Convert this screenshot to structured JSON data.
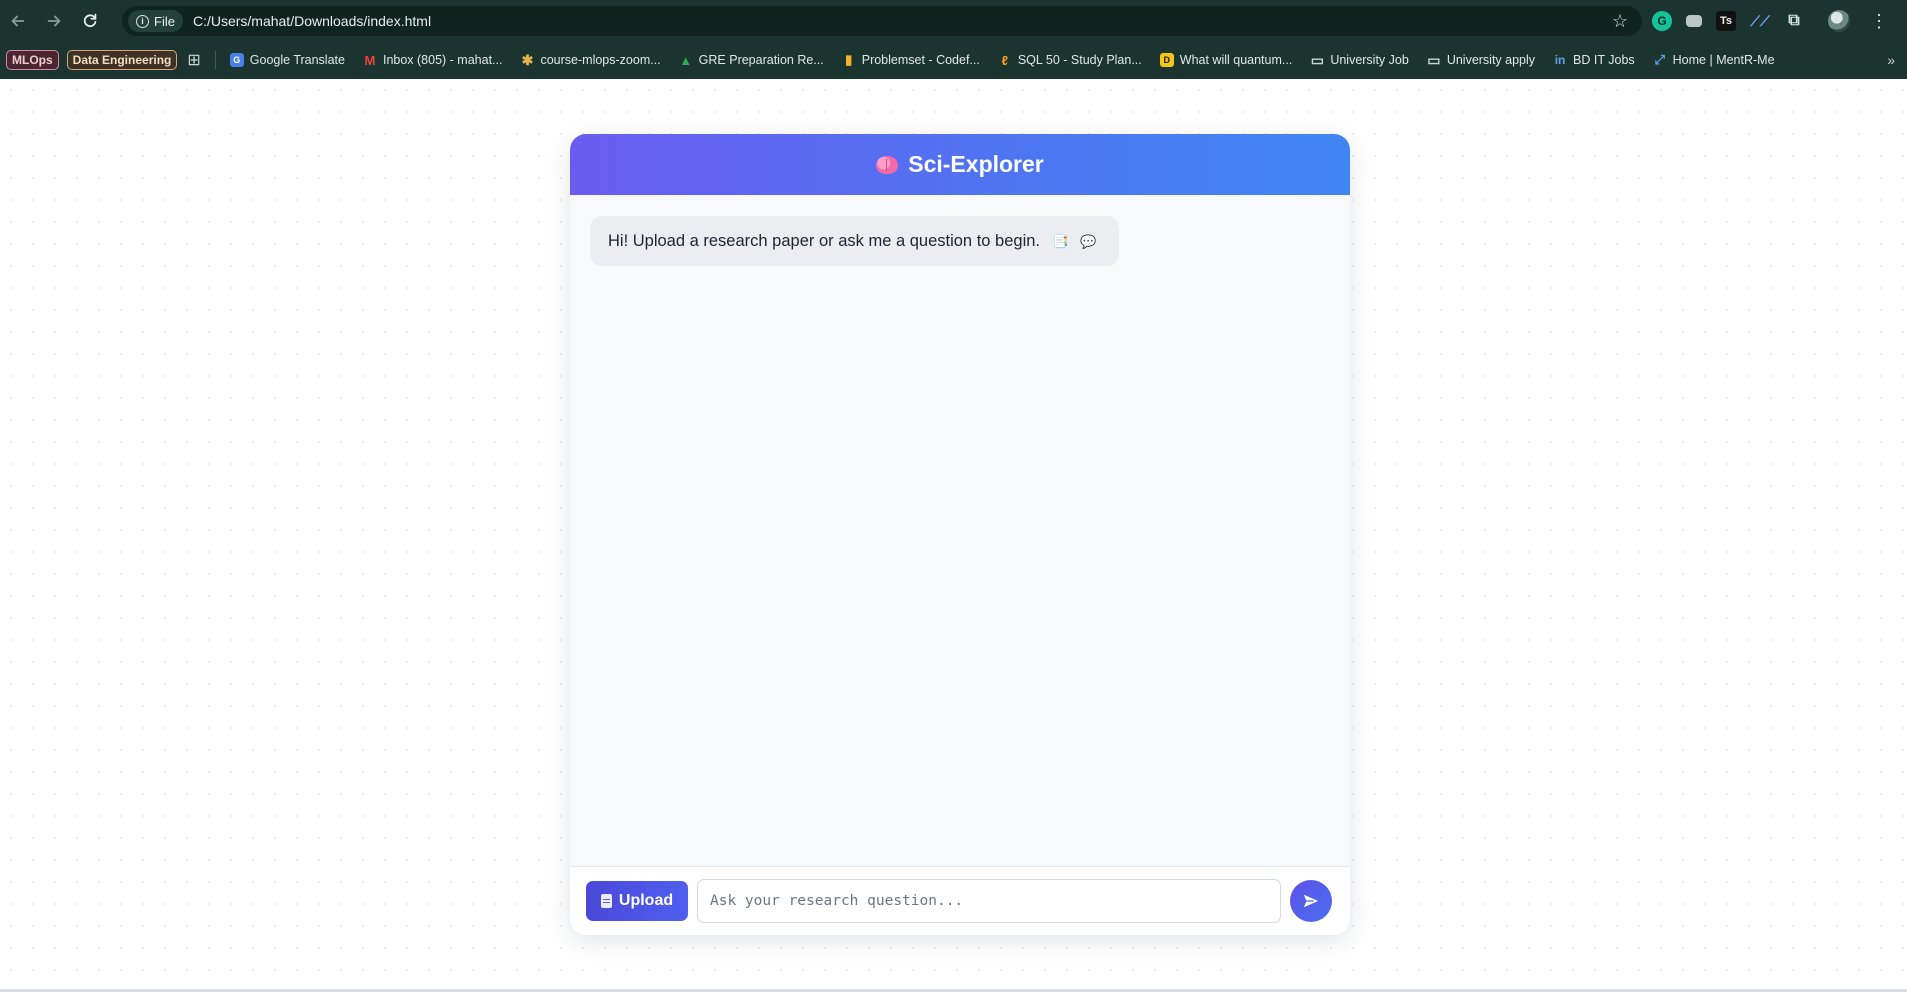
{
  "browser": {
    "address": {
      "scheme_label": "File",
      "url": "C:/Users/mahat/Downloads/index.html"
    },
    "icons": {
      "back": "arrow-left-icon",
      "forward": "arrow-right-icon",
      "reload": "reload-icon",
      "info": "info-icon",
      "bookmark_star": "star-icon",
      "extensions": [
        "grammarly-icon",
        "toggle-extension-icon",
        "ts-extension-icon",
        "ai-extension-icon",
        "puzzle-icon"
      ],
      "profile": "avatar",
      "more_bookmarks": "chevron-double-right-icon"
    },
    "bookmark_groups": [
      {
        "label": "MLOps",
        "color": "#d68aa0"
      },
      {
        "label": "Data Engineering",
        "color": "#d4a678"
      }
    ],
    "bookmarks": [
      {
        "label": "Google Translate",
        "icon": "google-translate-icon"
      },
      {
        "label": "Inbox (805) - mahat...",
        "icon": "gmail-icon"
      },
      {
        "label": "course-mlops-zoom...",
        "icon": "slack-icon"
      },
      {
        "label": "GRE Preparation Re...",
        "icon": "google-drive-icon"
      },
      {
        "label": "Problemset - Codef...",
        "icon": "codeforces-icon"
      },
      {
        "label": "SQL 50 - Study Plan...",
        "icon": "leetcode-icon"
      },
      {
        "label": "What will quantum...",
        "icon": "d-icon"
      },
      {
        "label": "University Job",
        "icon": "folder-icon"
      },
      {
        "label": "University apply",
        "icon": "folder-icon"
      },
      {
        "label": "BD IT Jobs",
        "icon": "linkedin-icon"
      },
      {
        "label": "Home | MentR-Me",
        "icon": "mentrme-icon"
      }
    ]
  },
  "app": {
    "title": "Sci-Explorer",
    "title_icon": "brain-icon",
    "accent_gradient": [
      "#6a5cf0",
      "#3f86f3"
    ],
    "messages": [
      {
        "role": "assistant",
        "text": "Hi! Upload a research paper or ask me a question to begin.",
        "emoji": "📑 💬"
      }
    ],
    "footer": {
      "upload_label": "Upload",
      "upload_icon": "document-icon",
      "input_value": "",
      "input_placeholder": "Ask your research question...",
      "send_icon": "send-icon"
    }
  }
}
